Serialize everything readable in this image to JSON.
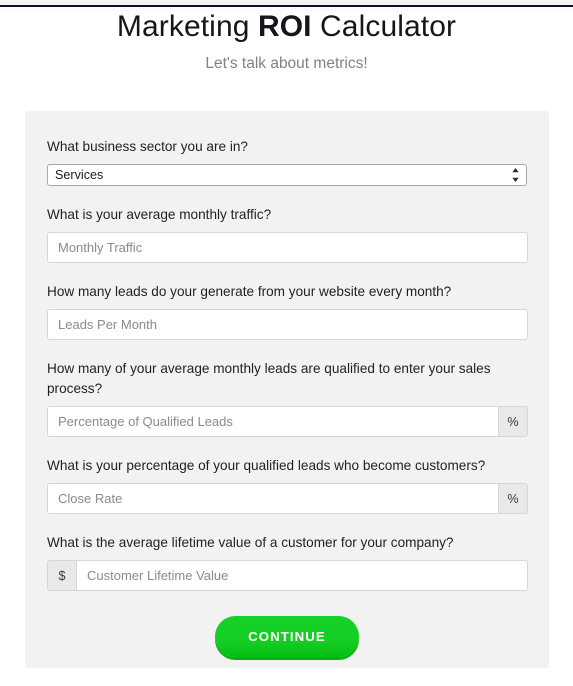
{
  "colors": {
    "page_background": "#ffffff",
    "panel_background": "#f2f2f2",
    "top_rule": "#0d0f2b",
    "title": "#15151c",
    "subtitle": "#7c8190",
    "accent_green": "#16cd24",
    "accent_green_shadow": "#04b40f",
    "input_border": "#d6d6d6",
    "addon_background": "#e9e9e9"
  },
  "header": {
    "title_part_1": "Marketing ",
    "title_strong": "ROI",
    "title_part_2": " Calculator",
    "title_full": "Marketing ROI Calculator",
    "subtitle": "Let's talk about metrics!"
  },
  "form": {
    "fields": [
      {
        "id": "business-sector",
        "label": "What business sector you are in?",
        "control": "select",
        "selected_value": "Services",
        "options": [
          "Services"
        ],
        "stepper_icon": "select-stepper-icon"
      },
      {
        "id": "monthly-traffic",
        "label": "What is your average monthly traffic?",
        "control": "text",
        "value": "",
        "placeholder": "Monthly Traffic",
        "addon": null
      },
      {
        "id": "leads-per-month",
        "label": "How many leads do your generate from your website every month?",
        "control": "text",
        "value": "",
        "placeholder": "Leads Per Month",
        "addon": null
      },
      {
        "id": "qualified-leads-percentage",
        "label": "How many of your average monthly leads are qualified to enter your sales process?",
        "control": "text",
        "value": "",
        "placeholder": "Percentage of Qualified Leads",
        "addon": "%",
        "addon_position": "suffix"
      },
      {
        "id": "close-rate",
        "label": "What is your percentage of your qualified leads who become customers?",
        "control": "text",
        "value": "",
        "placeholder": "Close Rate",
        "addon": "%",
        "addon_position": "suffix"
      },
      {
        "id": "customer-lifetime-value",
        "label": "What is the average lifetime value of a customer for your company?",
        "control": "text",
        "value": "",
        "placeholder": "Customer Lifetime Value",
        "addon": "$",
        "addon_position": "prefix"
      }
    ],
    "submit_label": "CONTINUE"
  }
}
